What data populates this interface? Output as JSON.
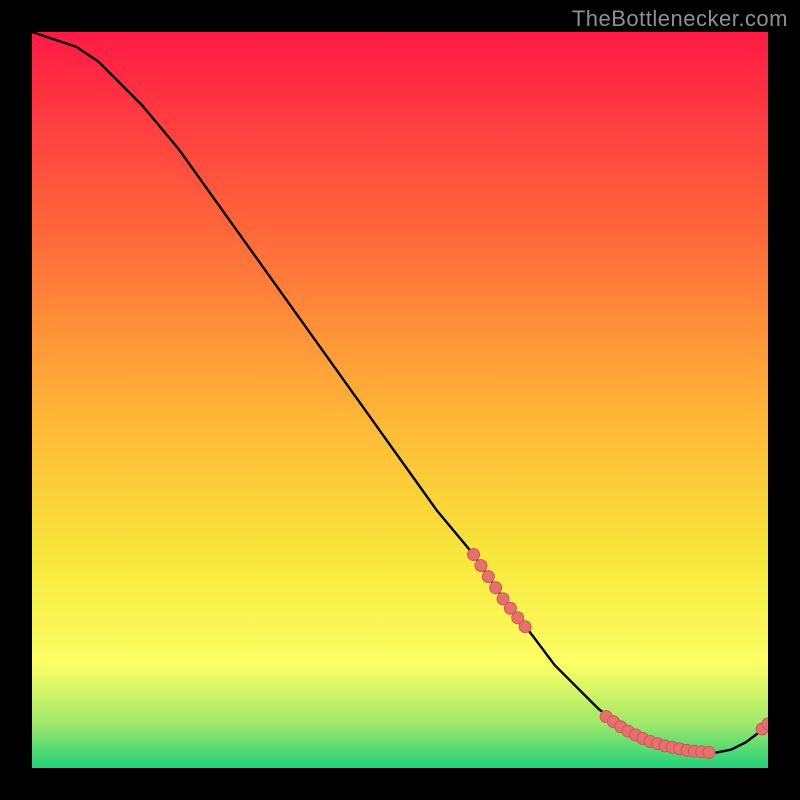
{
  "attribution": "TheBottlenecker.com",
  "colors": {
    "page_bg": "#000000",
    "attribution_text": "#8f8f8f",
    "curve": "#000000",
    "marker_fill": "#e76f6c",
    "marker_stroke": "#c95a58",
    "gradient_top": "#ff1a44",
    "gradient_mid_upper": "#ff6a3a",
    "gradient_mid": "#ffb537",
    "gradient_mid_lower": "#f7e93b",
    "gradient_low_yellow": "#fbff65",
    "gradient_low_green": "#9fe76a",
    "gradient_bottom": "#20d27a"
  },
  "chart_data": {
    "type": "line",
    "title": "",
    "xlabel": "",
    "ylabel": "",
    "xlim": [
      0,
      100
    ],
    "ylim": [
      0,
      100
    ],
    "grid": false,
    "legend": false,
    "series": [
      {
        "name": "curve",
        "x": [
          0,
          3,
          6,
          9,
          12,
          15,
          20,
          25,
          30,
          35,
          40,
          45,
          50,
          55,
          60,
          64,
          68,
          71,
          74,
          77,
          79,
          81,
          83,
          85,
          87,
          89,
          91,
          93,
          95,
          97,
          99,
          100
        ],
        "y": [
          100,
          99,
          98,
          96,
          93,
          90,
          84,
          77,
          70,
          63,
          56,
          49,
          42,
          35,
          29,
          23,
          18,
          14,
          11,
          8,
          6.5,
          5,
          4,
          3.3,
          2.8,
          2.4,
          2.2,
          2.1,
          2.5,
          3.5,
          5,
          6
        ]
      }
    ],
    "markers": [
      {
        "x": 60,
        "y": 29
      },
      {
        "x": 61,
        "y": 27.5
      },
      {
        "x": 62,
        "y": 26
      },
      {
        "x": 63,
        "y": 24.5
      },
      {
        "x": 64,
        "y": 23
      },
      {
        "x": 65,
        "y": 21.7
      },
      {
        "x": 66,
        "y": 20.4
      },
      {
        "x": 67,
        "y": 19.2
      },
      {
        "x": 78,
        "y": 7
      },
      {
        "x": 79,
        "y": 6.3
      },
      {
        "x": 80,
        "y": 5.6
      },
      {
        "x": 81,
        "y": 5
      },
      {
        "x": 82,
        "y": 4.5
      },
      {
        "x": 83,
        "y": 4
      },
      {
        "x": 84,
        "y": 3.6
      },
      {
        "x": 85,
        "y": 3.3
      },
      {
        "x": 86,
        "y": 3
      },
      {
        "x": 87,
        "y": 2.8
      },
      {
        "x": 88,
        "y": 2.6
      },
      {
        "x": 89,
        "y": 2.4
      },
      {
        "x": 90,
        "y": 2.3
      },
      {
        "x": 91,
        "y": 2.2
      },
      {
        "x": 92,
        "y": 2.1
      },
      {
        "x": 99.2,
        "y": 5.3
      },
      {
        "x": 100,
        "y": 6
      }
    ]
  }
}
